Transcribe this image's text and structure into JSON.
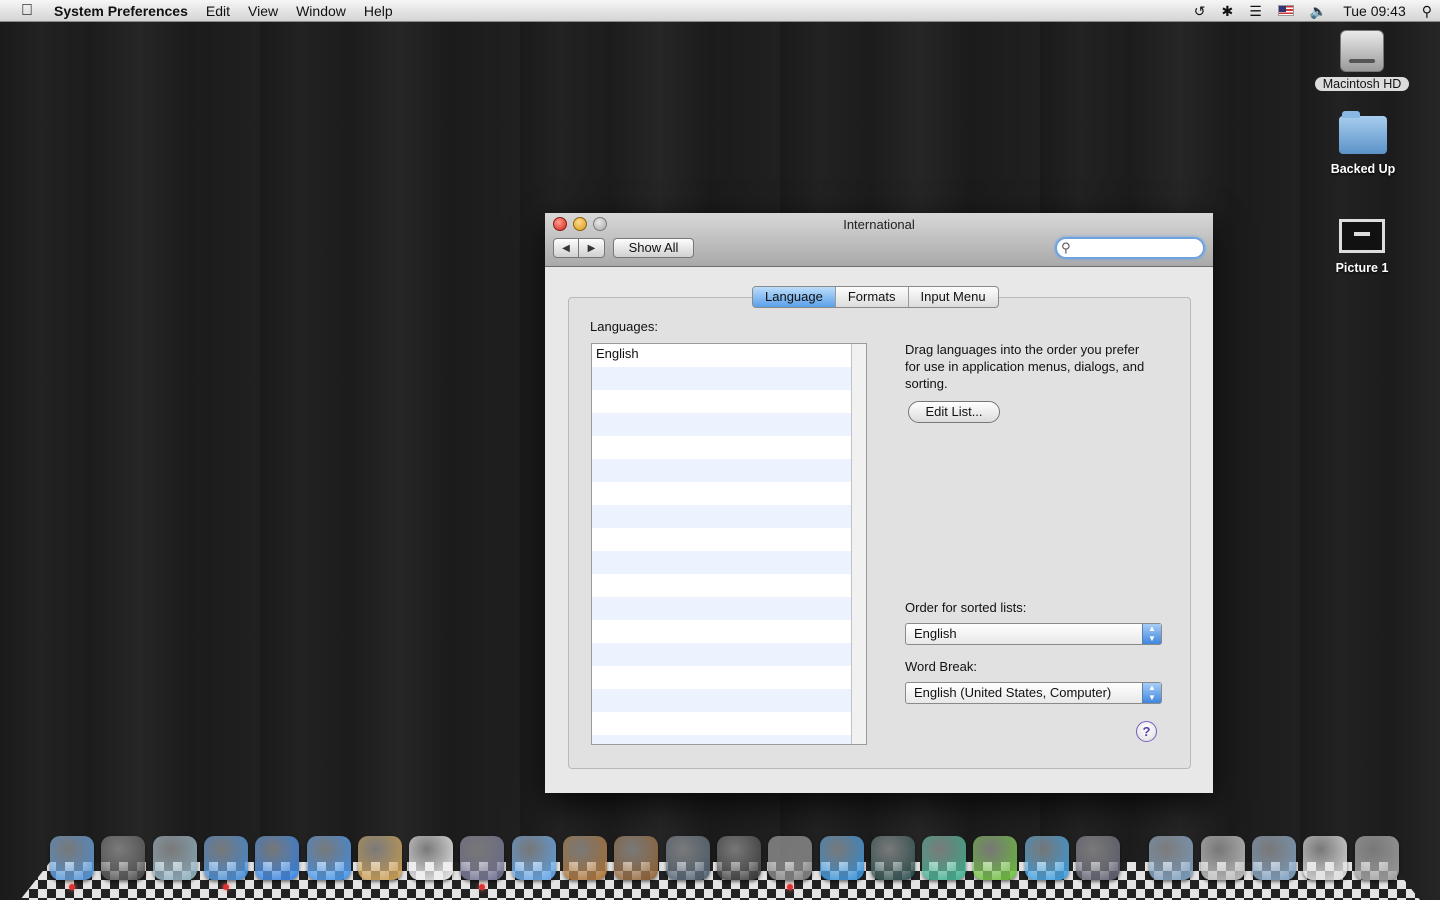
{
  "menubar": {
    "apple": "",
    "app_name": "System Preferences",
    "items": [
      "Edit",
      "View",
      "Window",
      "Help"
    ],
    "clock": "Tue 09:43"
  },
  "desktop": {
    "icons": [
      {
        "label": "Macintosh HD",
        "icon": "hard-drive-icon"
      },
      {
        "label": "Backed Up",
        "icon": "folder-icon"
      },
      {
        "label": "Picture 1",
        "icon": "screenshot-file-icon"
      }
    ]
  },
  "window": {
    "title": "International",
    "show_all": "Show All",
    "back_glyph": "◀",
    "forward_glyph": "▶",
    "search_placeholder": "",
    "tabs": [
      {
        "label": "Language",
        "active": true
      },
      {
        "label": "Formats",
        "active": false
      },
      {
        "label": "Input Menu",
        "active": false
      }
    ],
    "languages_label": "Languages:",
    "languages": [
      "English"
    ],
    "description": "Drag languages into the order you prefer for use in application menus, dialogs, and sorting.",
    "edit_list": "Edit List...",
    "sort_label": "Order for sorted lists:",
    "sort_value": "English",
    "word_break_label": "Word Break:",
    "word_break_value": "English (United States, Computer)",
    "help_glyph": "?"
  },
  "dock": {
    "apps": [
      {
        "name": "finder-icon",
        "color": "#4a8fd6"
      },
      {
        "name": "dashboard-icon",
        "color": "#444"
      },
      {
        "name": "mail-icon",
        "color": "#8ab"
      },
      {
        "name": "safari-icon",
        "color": "#3b86d4"
      },
      {
        "name": "ichat-icon",
        "color": "#2a7be0"
      },
      {
        "name": "iweb-icon",
        "color": "#3a8ee8"
      },
      {
        "name": "address-book-icon",
        "color": "#c99a4a"
      },
      {
        "name": "ical-icon",
        "color": "#eee"
      },
      {
        "name": "iphoto-icon",
        "color": "#668"
      },
      {
        "name": "itunes-icon",
        "color": "#5aa0e6"
      },
      {
        "name": "preview-icon",
        "color": "#a66a2a"
      },
      {
        "name": "garageband-icon",
        "color": "#8a5a2a"
      },
      {
        "name": "spaces-icon",
        "color": "#456"
      },
      {
        "name": "time-machine-icon",
        "color": "#333"
      },
      {
        "name": "system-preferences-icon",
        "color": "#777"
      },
      {
        "name": "x11-icon",
        "color": "#2a8ad6"
      },
      {
        "name": "quicktime-icon",
        "color": "#244"
      },
      {
        "name": "growl-icon",
        "color": "#3a8"
      },
      {
        "name": "limewire-icon",
        "color": "#6b3"
      },
      {
        "name": "blue-app-icon",
        "color": "#39d"
      },
      {
        "name": "automator-icon",
        "color": "#556"
      },
      {
        "name": "applications-folder-icon",
        "color": "#79b"
      },
      {
        "name": "documents-stack-icon",
        "color": "#bbb"
      },
      {
        "name": "downloads-folder-icon",
        "color": "#79b"
      },
      {
        "name": "mail-stack-icon",
        "color": "#ddd"
      },
      {
        "name": "trash-icon",
        "color": "#999"
      }
    ]
  }
}
